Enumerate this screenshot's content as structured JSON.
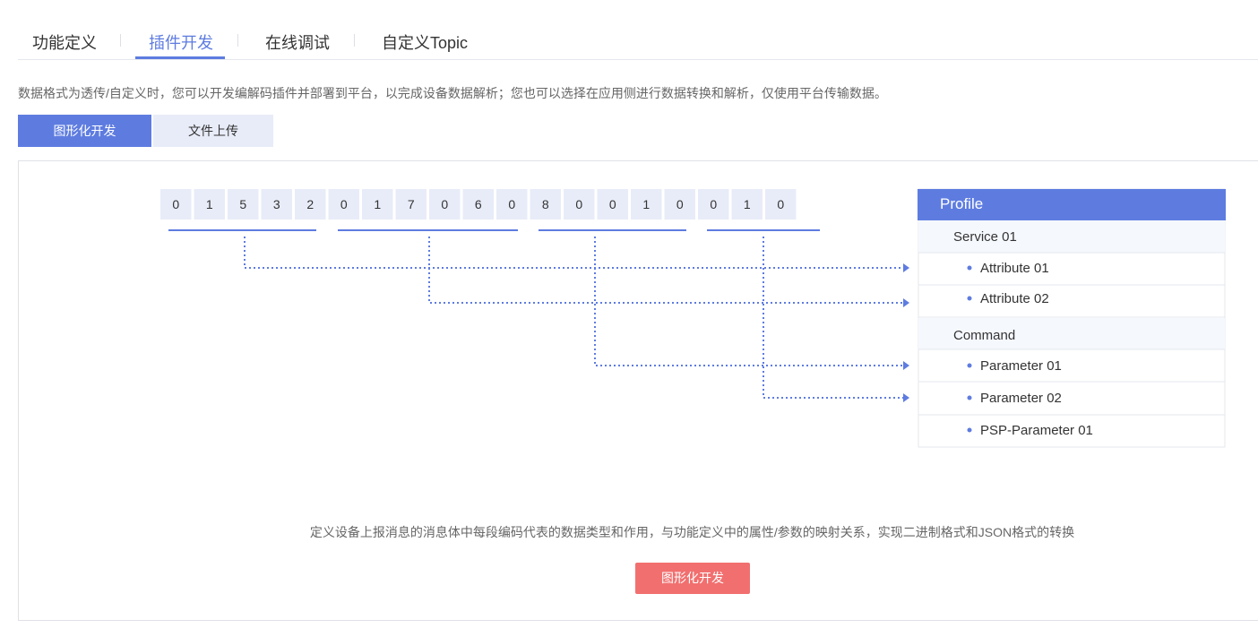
{
  "tabs": [
    {
      "label": "功能定义"
    },
    {
      "label": "插件开发"
    },
    {
      "label": "在线调试"
    },
    {
      "label": "自定义Topic"
    }
  ],
  "active_tab": "插件开发",
  "description": "数据格式为透传/自定义时，您可以开发编解码插件并部署到平台，以完成设备数据解析；您也可以选择在应用侧进行数据转换和解析，仅使用平台传输数据。",
  "mode_buttons": {
    "graphical": "图形化开发",
    "upload": "文件上传"
  },
  "diagram": {
    "bytes": [
      "0",
      "1",
      "5",
      "3",
      "2",
      "0",
      "1",
      "7",
      "0",
      "6",
      "0",
      "8",
      "0",
      "0",
      "1",
      "0",
      "0",
      "1",
      "0"
    ],
    "profile": {
      "title": "Profile",
      "rows": [
        {
          "label": "Service 01",
          "kind": "group"
        },
        {
          "label": "Attribute 01",
          "kind": "item"
        },
        {
          "label": "Attribute 02",
          "kind": "item"
        },
        {
          "label": "Command",
          "kind": "group"
        },
        {
          "label": "Parameter 01",
          "kind": "item"
        },
        {
          "label": "Parameter 02",
          "kind": "item"
        },
        {
          "label": "PSP-Parameter 01",
          "kind": "item"
        }
      ]
    }
  },
  "caption": "定义设备上报消息的消息体中每段编码代表的数据类型和作用，与功能定义中的属性/参数的映射关系，实现二进制格式和JSON格式的转换",
  "cta_label": "图形化开发",
  "colors": {
    "accent": "#5e7ce0",
    "cta": "#f26f6f",
    "byte_bg": "#e8ecf8"
  }
}
